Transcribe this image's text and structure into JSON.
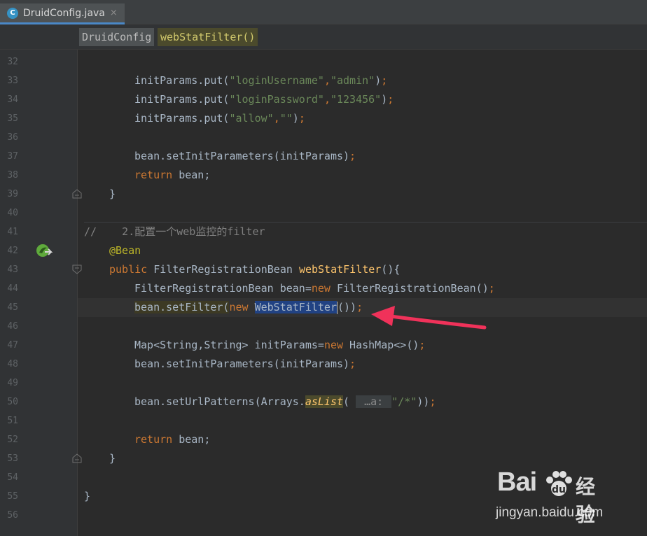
{
  "tab": {
    "icon_letter": "C",
    "label": "DruidConfig.java",
    "close": "×"
  },
  "breadcrumb": {
    "class_name": "DruidConfig",
    "method_name": "webStatFilter()"
  },
  "lines": [
    {
      "n": "32"
    },
    {
      "n": "33",
      "text": "initParams.put(\"loginUsername\",\"admin\");"
    },
    {
      "n": "34",
      "text": "initParams.put(\"loginPassword\",\"123456\");"
    },
    {
      "n": "35",
      "text": "initParams.put(\"allow\",\"\");"
    },
    {
      "n": "36"
    },
    {
      "n": "37",
      "text": "bean.setInitParameters(initParams);"
    },
    {
      "n": "38",
      "text": "return bean;"
    },
    {
      "n": "39",
      "text": "}"
    },
    {
      "n": "40"
    },
    {
      "n": "41",
      "text": "//    2.配置一个web监控的filter"
    },
    {
      "n": "42",
      "text": "@Bean"
    },
    {
      "n": "43",
      "text": "public FilterRegistrationBean webStatFilter(){"
    },
    {
      "n": "44",
      "text": "FilterRegistrationBean bean=new FilterRegistrationBean();"
    },
    {
      "n": "45",
      "text": "bean.setFilter(new WebStatFilter());"
    },
    {
      "n": "46"
    },
    {
      "n": "47",
      "text": "Map<String,String> initParams=new HashMap<>();"
    },
    {
      "n": "48",
      "text": "bean.setInitParameters(initParams);"
    },
    {
      "n": "49"
    },
    {
      "n": "50",
      "text": "bean.setUrlPatterns(Arrays.asList( …a: \"/*\"));"
    },
    {
      "n": "51"
    },
    {
      "n": "52",
      "text": "return bean;"
    },
    {
      "n": "53",
      "text": "}"
    },
    {
      "n": "54"
    },
    {
      "n": "55",
      "text": "}"
    },
    {
      "n": "56"
    }
  ],
  "tokens": {
    "33": [
      "initParams.put(",
      "\"loginUsername\"",
      ",",
      "\"admin\"",
      ")",
      ";"
    ],
    "34": [
      "initParams.put(",
      "\"loginPassword\"",
      ",",
      "\"123456\"",
      ")",
      ";"
    ],
    "35": [
      "initParams.put(",
      "\"allow\"",
      ",",
      "\"\"",
      ")",
      ";"
    ],
    "37": [
      "bean.setInitParameters(initParams)",
      ";"
    ],
    "38": [
      "return",
      " bean;"
    ],
    "41": [
      "//    2.配置一个web监控的filter"
    ],
    "42": [
      "@Bean"
    ],
    "43": [
      "public",
      " FilterRegistrationBean ",
      "webStatFilter",
      "(){"
    ],
    "44": [
      "FilterRegistrationBean bean=",
      "new",
      " FilterRegistrationBean()",
      ";"
    ],
    "45": [
      "bean.setFilter(",
      "new",
      " ",
      "WebStatFilter",
      "())",
      ";"
    ],
    "47": [
      "Map<String,String> initParams=",
      "new",
      " HashMap<>()",
      ";"
    ],
    "48": [
      "bean.setInitParameters(initParams)",
      ";"
    ],
    "50": [
      "bean.setUrlPatterns(Arrays.",
      "asList",
      "( ",
      " …a: ",
      "\"/*\"",
      "))",
      ";"
    ],
    "52": [
      "return",
      " bean;"
    ]
  },
  "watermark": {
    "brand": "Bai",
    "brand_cn": "经验",
    "url": "jingyan.baidu.com"
  },
  "colors": {
    "accent": "#4a88c7",
    "arrow": "#f0325a",
    "selection": "#214283"
  }
}
